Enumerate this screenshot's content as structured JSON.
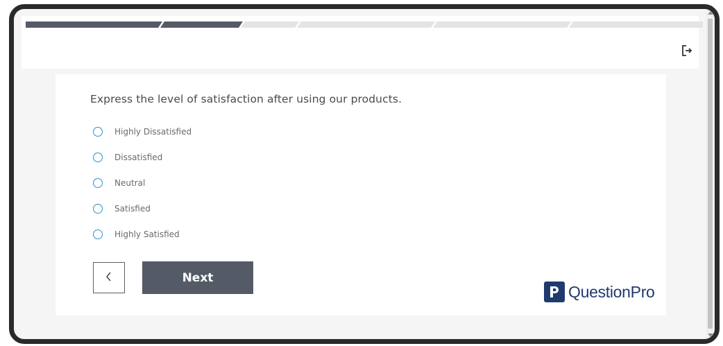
{
  "survey": {
    "progress": {
      "total_segments": 6,
      "completed_segments": 2,
      "fraction": 0.33
    },
    "question": "Express the level of satisfaction after using our products.",
    "options": [
      {
        "label": "Highly Dissatisfied",
        "selected": false
      },
      {
        "label": "Dissatisfied",
        "selected": false
      },
      {
        "label": "Neutral",
        "selected": false
      },
      {
        "label": "Satisfied",
        "selected": false
      },
      {
        "label": "Highly Satisfied",
        "selected": false
      }
    ],
    "next_label": "Next",
    "brand": "QuestionPro"
  },
  "colors": {
    "progress_done": "#545a66",
    "progress_todo": "#e4e4e4",
    "radio_border": "#2b8fcf",
    "button_bg": "#545a66",
    "brand": "#1f3a6e"
  },
  "icons": {
    "exit": "exit-icon",
    "back": "chevron-left-icon",
    "logo": "questionpro-logo-icon"
  }
}
